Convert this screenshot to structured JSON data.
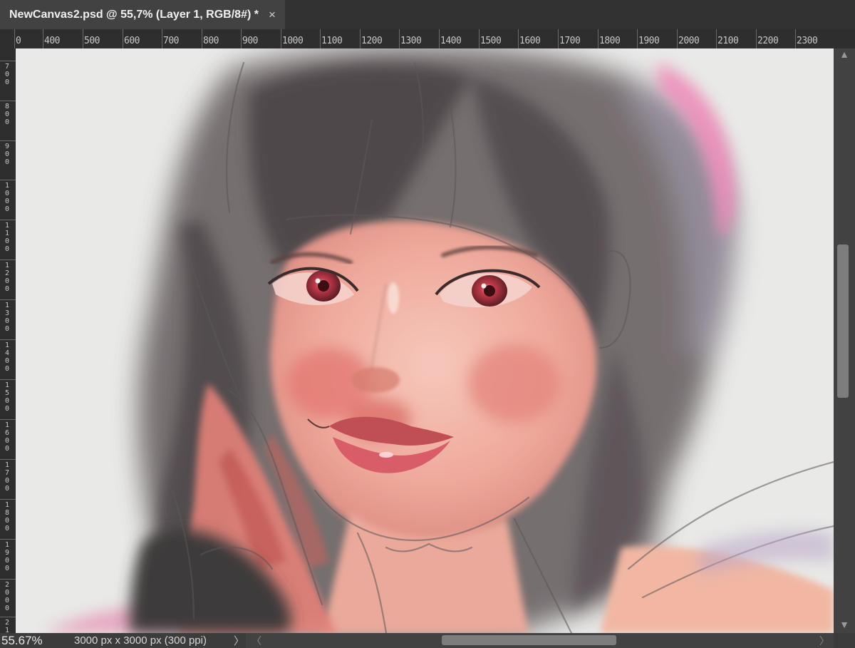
{
  "tab": {
    "title": "NewCanvas2.psd @ 55,7% (Layer 1, RGB/8#) *",
    "close": "×"
  },
  "ruler_top": [
    "0",
    "400",
    "500",
    "600",
    "700",
    "800",
    "900",
    "1000",
    "1100",
    "1200",
    "1300",
    "1400",
    "1500",
    "1600",
    "1700",
    "1800",
    "1900",
    "2000",
    "2100",
    "2200",
    "2300"
  ],
  "ruler_left": [
    "7\n0\n0",
    "8\n0\n0",
    "9\n0\n0",
    "1\n0\n0\n0",
    "1\n1\n0\n0",
    "1\n2\n0\n0",
    "1\n3\n0\n0",
    "1\n4\n0\n0",
    "1\n5\n0\n0",
    "1\n6\n0\n0",
    "1\n7\n0\n0",
    "1\n8\n0\n0",
    "1\n9\n0\n0",
    "2\n0\n0\n0",
    "2\n1"
  ],
  "status": {
    "zoom": "55.67%",
    "doc_info": "3000 px x 3000 px (300 ppi)",
    "arrow": "〉"
  },
  "scroll": {
    "up": "▲",
    "down": "▼",
    "left": "〈",
    "right": "〉"
  },
  "canvas": {
    "content": "digital-painting-portrait",
    "colors": {
      "background": "#e9e9e7",
      "hair": "#4a4446",
      "skin": "#f1b7a8",
      "blush": "#e2766f",
      "lips": "#c9525d",
      "eyes": "#c13a48",
      "accent_pink": "#f08ab8"
    }
  }
}
